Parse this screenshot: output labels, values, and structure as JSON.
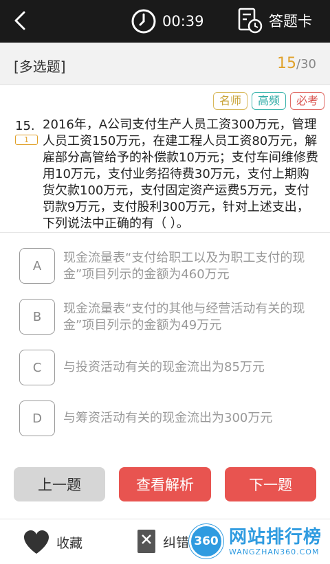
{
  "topbar": {
    "timer": "00:39",
    "card_label": "答题卡"
  },
  "question_header": {
    "type": "[多选题]",
    "current": "15",
    "total": "/30"
  },
  "tags": [
    "名师",
    "高频",
    "必考"
  ],
  "question": {
    "number": "15.",
    "badge": "1",
    "text": "2016年，A公司支付生产人员工资300万元，管理人员工资150万元，在建工程人员工资80万元，解雇部分高管给予的补偿款10万元；支付车间维修费用10万元，支付业务招待费30万元，支付上期购货欠款100万元，支付固定资产运费5万元，支付罚款9万元，支付股利300万元，针对上述支出，下列说法中正确的有（    ）。"
  },
  "options": [
    {
      "key": "A",
      "text": "现金流量表“支付给职工以及为职工支付的现金”项目列示的金额为460万元"
    },
    {
      "key": "B",
      "text": "现金流量表“支付的其他与经营活动有关的现金”项目列示的金额为49万元"
    },
    {
      "key": "C",
      "text": "与投资活动有关的现金流出为85万元"
    },
    {
      "key": "D",
      "text": "与筹资活动有关的现金流出为300万元"
    }
  ],
  "buttons": {
    "prev": "上一题",
    "analysis": "查看解析",
    "next": "下一题"
  },
  "bottombar": {
    "favorite": "收藏",
    "correction": "纠错"
  },
  "watermark": {
    "circle": "360",
    "title": "网站排行榜",
    "subtitle": "WANGZHAN360.COM"
  },
  "colors": {
    "accent": "#e85450",
    "progress": "#e0a12a",
    "watermark": "#2f9be0"
  }
}
